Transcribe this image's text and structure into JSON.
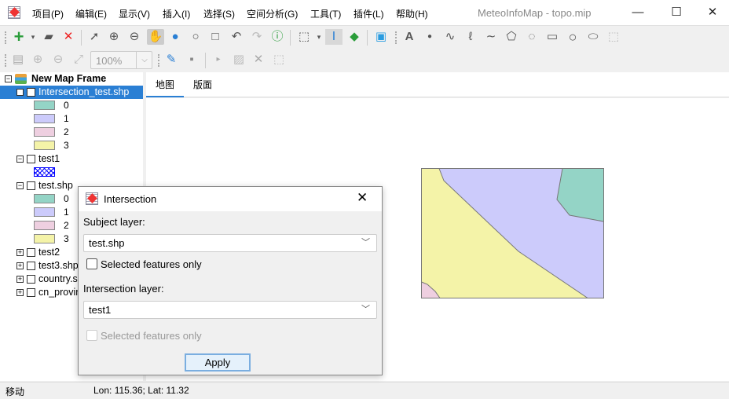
{
  "window": {
    "title": "MeteoInfoMap - topo.mip",
    "minimize": "—",
    "maximize": "☐",
    "close": "✕"
  },
  "menu": [
    "项目(P)",
    "编辑(E)",
    "显示(V)",
    "插入(I)",
    "选择(S)",
    "空间分析(G)",
    "工具(T)",
    "插件(L)",
    "帮助(H)"
  ],
  "toolbar": {
    "zoom_value": "100%"
  },
  "tree": {
    "root": "New Map Frame",
    "layers": [
      {
        "name": "Intersection_test.shp",
        "checked": true,
        "selected": true,
        "expanded": true,
        "legend": [
          "0",
          "1",
          "2",
          "3"
        ]
      },
      {
        "name": "test1",
        "checked": false,
        "expanded": true,
        "legend": [
          ""
        ]
      },
      {
        "name": "test.shp",
        "checked": false,
        "expanded": true,
        "legend": [
          "0",
          "1",
          "2",
          "3"
        ]
      },
      {
        "name": "test2",
        "checked": false,
        "expanded": false
      },
      {
        "name": "test3.shp",
        "checked": false,
        "expanded": false
      },
      {
        "name": "country.shp",
        "checked": false,
        "expanded": false
      },
      {
        "name": "cn_province",
        "checked": false,
        "expanded": false
      }
    ]
  },
  "legend_colors": [
    "#94d4c6",
    "#cccbfb",
    "#eecfe0",
    "#f4f3a8"
  ],
  "tabs": [
    {
      "label": "地图",
      "active": true
    },
    {
      "label": "版面",
      "active": false
    }
  ],
  "dialog": {
    "title": "Intersection",
    "subject_label": "Subject layer:",
    "subject_value": "test.shp",
    "subject_selected_only": "Selected features only",
    "intersection_label": "Intersection layer:",
    "intersection_value": "test1",
    "intersection_selected_only": "Selected features only",
    "apply": "Apply"
  },
  "status": {
    "mode": "移动",
    "coords": "Lon: 115.36; Lat: 11.32"
  }
}
